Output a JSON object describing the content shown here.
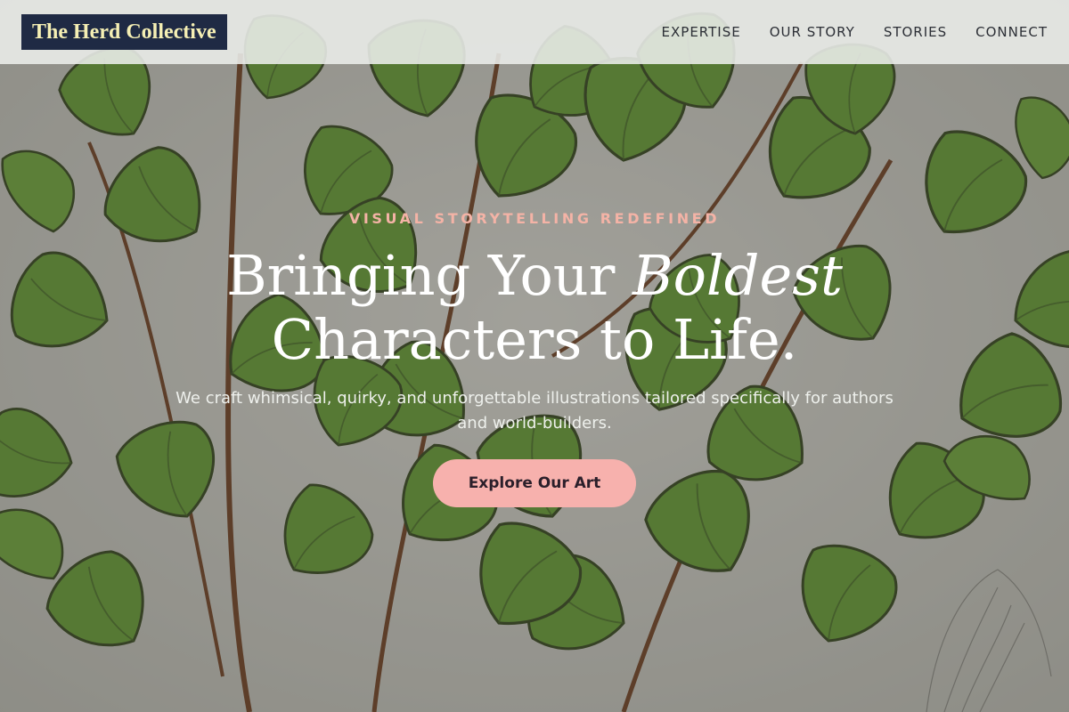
{
  "header": {
    "logo_text": "The Herd Collective",
    "nav": [
      {
        "label": "EXPERTISE"
      },
      {
        "label": "OUR STORY"
      },
      {
        "label": "STORIES"
      },
      {
        "label": "CONNECT"
      }
    ]
  },
  "hero": {
    "kicker": "VISUAL STORYTELLING REDEFINED",
    "headline_part1": "Bringing Your ",
    "headline_emphasis": "Boldest",
    "headline_part2": "Characters to Life.",
    "subtext": "We craft whimsical, quirky, and unforgettable illustrations tailored specifically for authors and world-builders.",
    "cta_label": "Explore Our Art",
    "background_image": "botanical-fern-illustration"
  },
  "colors": {
    "logo_background": "#1f2a44",
    "logo_text": "#f5efb4",
    "kicker": "#f4b3a6",
    "cta_background": "#f7b1ad",
    "leaf_green": "#5f9a2e"
  }
}
